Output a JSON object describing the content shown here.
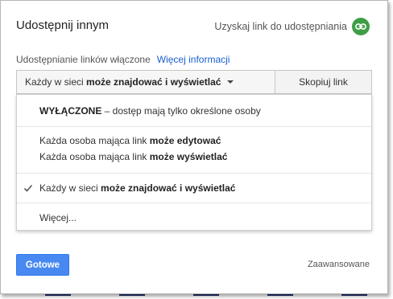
{
  "dialog": {
    "title": "Udostępnij innym",
    "get_link_label": "Uzyskaj link do udostępniania",
    "get_link_icon": "link-icon",
    "accent_green": "#3f9e45"
  },
  "sharing": {
    "status_label": "Udostępnianie linków włączone",
    "more_info_link": "Więcej informacji"
  },
  "dropdown": {
    "prefix": "Każdy w sieci ",
    "bold": "może znajdować i wyświetlać",
    "caret_icon": "caret-down-icon"
  },
  "copy_button": "Skopiuj link",
  "menu": {
    "items": [
      {
        "bold": "WYŁĄCZONE",
        "rest": " – dostęp mają tylko określone osoby",
        "selected": false
      },
      {
        "rest": "Każda osoba mająca link ",
        "bold": "może edytować",
        "selected": false
      },
      {
        "rest": "Każda osoba mająca link ",
        "bold": "może wyświetlać",
        "selected": false
      },
      {
        "rest": "Każdy w sieci ",
        "bold": "może znajdować i wyświetlać",
        "selected": true
      },
      {
        "rest": "Więcej...",
        "selected": false
      }
    ],
    "check_icon": "checkmark-icon"
  },
  "footer": {
    "primary_button": "Gotowe",
    "advanced_link": "Zaawansowane",
    "primary_color": "#4889f1"
  }
}
